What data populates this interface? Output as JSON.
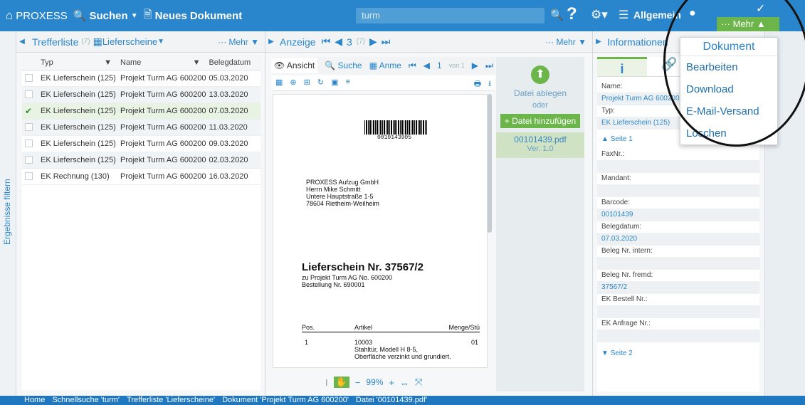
{
  "topbar": {
    "brand": "PROXESS",
    "search_label": "Suchen",
    "new_doc_label": "Neues Dokument",
    "search_value": "turm",
    "help": "?",
    "profile": "Allgemein"
  },
  "left": {
    "title": "Trefferliste",
    "count": "(7)",
    "view": "Lieferscheine",
    "more": "Mehr",
    "vtab": "Ergebnisse filtern",
    "columns": [
      "Typ",
      "Name",
      "Belegdatum"
    ],
    "rows": [
      [
        "EK Lieferschein (125)",
        "Projekt Turm AG 600200",
        "05.03.2020"
      ],
      [
        "EK Lieferschein (125)",
        "Projekt Turm AG 600200",
        "13.03.2020"
      ],
      [
        "EK Lieferschein (125)",
        "Projekt Turm AG 600200",
        "07.03.2020"
      ],
      [
        "EK Lieferschein (125)",
        "Projekt Turm AG 600200",
        "11.03.2020"
      ],
      [
        "EK Lieferschein (125)",
        "Projekt Turm AG 600200",
        "09.03.2020"
      ],
      [
        "EK Lieferschein (125)",
        "Projekt Turm AG 600200",
        "02.03.2020"
      ],
      [
        "EK Rechnung (130)",
        "Projekt Turm AG 600200",
        "16.03.2020"
      ]
    ],
    "selected_row": 2
  },
  "viewer": {
    "title": "Anzeige",
    "page": "3",
    "page_count": "(7)",
    "more": "Mehr",
    "tabs": [
      "Ansicht",
      "Suche",
      "Anme"
    ],
    "subpage": "1",
    "subpage_of": "von 1",
    "zoom": "99%",
    "doc": {
      "barcode": "0010143905",
      "address": [
        "PROXESS Aufzug GmbH",
        "Herrn Mike Schmitt",
        "Untere Hauptstraße 1-5",
        "78604 Rietheim-Weilheim"
      ],
      "heading": "Lieferschein Nr. 37567/2",
      "sub": [
        "zu Projekt Turm AG No. 600200",
        "Bestellung Nr. 690001"
      ],
      "cols": [
        "Pos.",
        "Artikel",
        "Menge/Stü"
      ],
      "line": [
        "1",
        "10003",
        "01"
      ],
      "line_desc": [
        "Stahltür, Modell H 8-5,",
        "Oberfläche verzinkt und grundiert."
      ]
    }
  },
  "files": {
    "drop_label": "Datei ablegen",
    "or": "oder",
    "add_label": "+ Datei hinzufügen",
    "file": "00101439.pdf",
    "version": "Ver. 1.0"
  },
  "info": {
    "title": "Informationen",
    "fields": [
      {
        "label": "Name:",
        "value": "Projekt Turm AG 600200"
      },
      {
        "label": "Typ:",
        "value": "EK Lieferschein (125)"
      }
    ],
    "section1": "Seite 1",
    "fields2": [
      {
        "label": "FaxNr.:",
        "value": ""
      },
      {
        "label": "Mandant:",
        "value": ""
      },
      {
        "label": "Barcode:",
        "value": "00101439"
      },
      {
        "label": "Belegdatum:",
        "value": "07.03.2020"
      },
      {
        "label": "Beleg Nr. intern:",
        "value": ""
      },
      {
        "label": "Beleg Nr. fremd:",
        "value": "37567/2"
      },
      {
        "label": "EK Bestell Nr.:",
        "value": ""
      },
      {
        "label": "EK Anfrage Nr.:",
        "value": ""
      }
    ],
    "section2": "Seite 2"
  },
  "menu": {
    "button": "Mehr",
    "header": "Dokument",
    "items": [
      "Bearbeiten",
      "Download",
      "E-Mail-Versand",
      "Löschen"
    ]
  },
  "breadcrumb": [
    "Home",
    "Schnellsuche 'turm'",
    "Trefferliste 'Lieferscheine'",
    "Dokument 'Projekt Turm AG 600200'",
    "Datei '00101439.pdf'"
  ]
}
